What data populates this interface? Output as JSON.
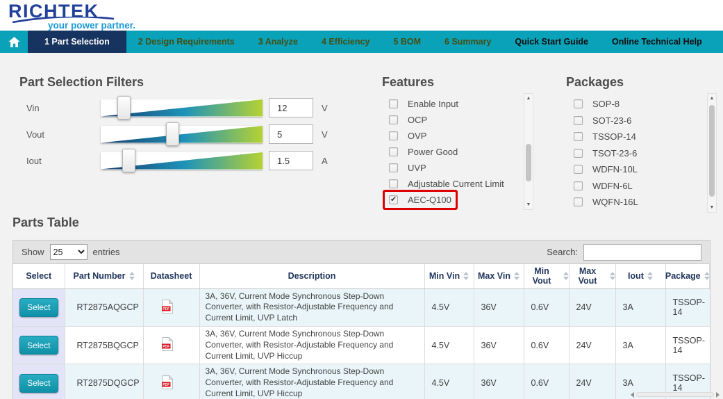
{
  "brand": {
    "logo": "RICHTEK",
    "tagline": "your power partner."
  },
  "nav": {
    "tabs": [
      {
        "label": "1 Part Selection",
        "active": true
      },
      {
        "label": "2 Design Requirements"
      },
      {
        "label": "3 Analyze"
      },
      {
        "label": "4 Efficiency"
      },
      {
        "label": "5 BOM"
      },
      {
        "label": "6 Summary"
      },
      {
        "label": "Quick Start Guide",
        "plain": true
      },
      {
        "label": "Online Technical Help",
        "plain": true
      }
    ]
  },
  "filters": {
    "title": "Part Selection Filters",
    "sliders": [
      {
        "label": "Vin",
        "value": "12",
        "unit": "V",
        "position_pct": 14
      },
      {
        "label": "Vout",
        "value": "5",
        "unit": "V",
        "position_pct": 44
      },
      {
        "label": "Iout",
        "value": "1.5",
        "unit": "A",
        "position_pct": 17
      }
    ]
  },
  "features": {
    "title": "Features",
    "items": [
      {
        "label": "Enable Input"
      },
      {
        "label": "OCP"
      },
      {
        "label": "OVP"
      },
      {
        "label": "Power Good"
      },
      {
        "label": "UVP"
      },
      {
        "label": "Adjustable Current Limit"
      },
      {
        "label": "AEC-Q100",
        "checked": true,
        "highlighted": true
      }
    ]
  },
  "packages": {
    "title": "Packages",
    "items": [
      {
        "label": "SOP-8"
      },
      {
        "label": "SOT-23-6"
      },
      {
        "label": "TSSOP-14"
      },
      {
        "label": "TSOT-23-6"
      },
      {
        "label": "WDFN-10L"
      },
      {
        "label": "WDFN-6L"
      },
      {
        "label": "WQFN-16L"
      }
    ]
  },
  "parts_table": {
    "title": "Parts Table",
    "toolbar": {
      "show_label": "Show",
      "entries_value": "25",
      "entries_suffix": "entries",
      "search_label": "Search:",
      "search_value": ""
    },
    "columns": [
      {
        "label": "Select"
      },
      {
        "label": "Part Number",
        "sortable": true
      },
      {
        "label": "Datasheet"
      },
      {
        "label": "Description"
      },
      {
        "label": "Min Vin",
        "sortable": true
      },
      {
        "label": "Max Vin",
        "sortable": true
      },
      {
        "label": "Min Vout",
        "sortable": true
      },
      {
        "label": "Max Vout",
        "sortable": true
      },
      {
        "label": "Iout",
        "sortable": true
      },
      {
        "label": "Package",
        "sortable": true
      }
    ],
    "rows": [
      {
        "select_label": "Select",
        "part_number": "RT2875AQGCP",
        "datasheet_icon": "pdf-icon",
        "description": "3A, 36V, Current Mode Synchronous Step-Down Converter, with Resistor-Adjustable Frequency and Current Limit, UVP Latch",
        "min_vin": "4.5V",
        "max_vin": "36V",
        "min_vout": "0.6V",
        "max_vout": "24V",
        "iout": "3A",
        "package": "TSSOP-14"
      },
      {
        "select_label": "Select",
        "part_number": "RT2875BQGCP",
        "datasheet_icon": "pdf-icon",
        "description": "3A, 36V, Current Mode Synchronous Step-Down Converter, with Resistor-Adjustable Frequency and Current Limit, UVP Hiccup",
        "min_vin": "4.5V",
        "max_vin": "36V",
        "min_vout": "0.6V",
        "max_vout": "24V",
        "iout": "3A",
        "package": "TSSOP-14"
      },
      {
        "select_label": "Select",
        "part_number": "RT2875DQGCP",
        "datasheet_icon": "pdf-icon",
        "description": "3A, 36V, Current Mode Synchronous Step-Down Converter, with Resistor-Adjustable Frequency and Current Limit, UVP Hiccup",
        "min_vin": "4.5V",
        "max_vin": "36V",
        "min_vout": "0.6V",
        "max_vout": "24V",
        "iout": "3A",
        "package": "TSSOP-14"
      }
    ]
  },
  "colors": {
    "nav_teal": "#0aa2b8",
    "active_tab_navy": "#17335f",
    "logo_blue": "#21409a",
    "tagline_cyan": "#1b9ad6",
    "slider_gradient_start": "#173a6b",
    "slider_gradient_mid": "#1e93b9",
    "slider_gradient_end": "#b5d233",
    "select_button_teal": "#16a0b6",
    "row_highlight_blue": "#e9f5f8",
    "select_cell_lavender": "#e4e4f8",
    "aec_highlight_red": "#dd0000",
    "header_text_navy": "#20365c"
  }
}
